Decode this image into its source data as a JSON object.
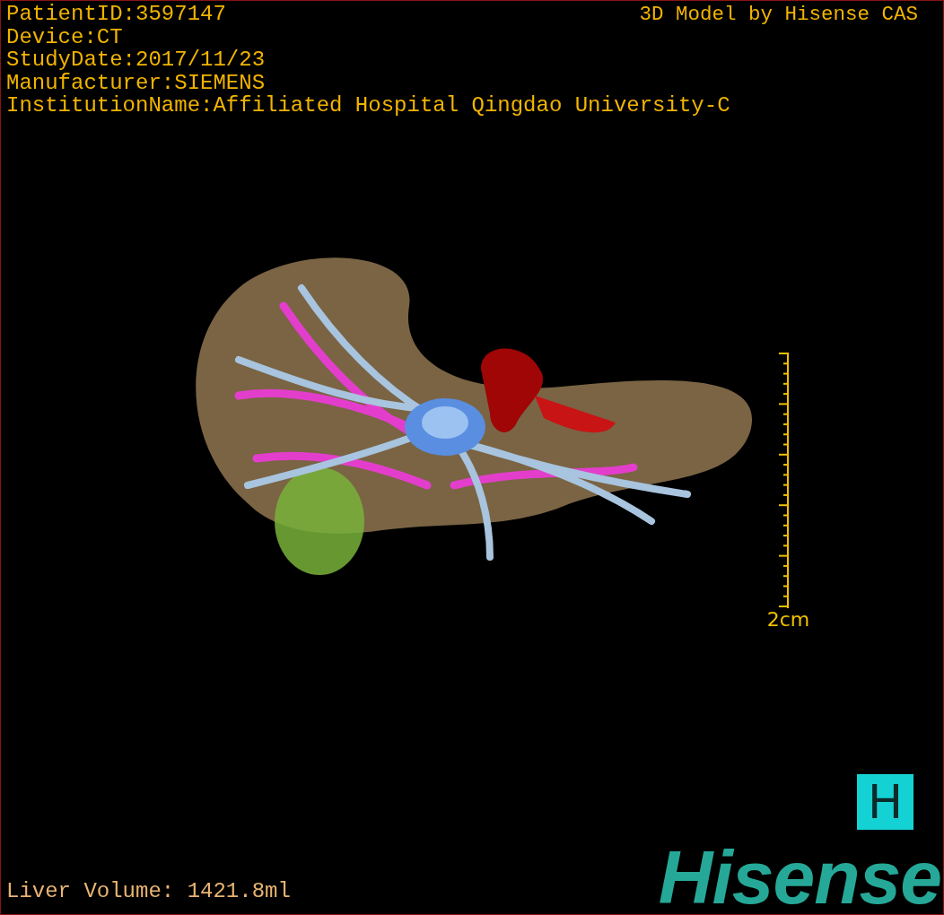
{
  "header": {
    "info_lines": [
      "PatientID:3597147",
      "Device:CT",
      "StudyDate:2017/11/23",
      "Manufacturer:SIEMENS",
      "InstitutionName:Affiliated Hospital Qingdao University-C"
    ],
    "title": "3D Model by Hisense CAS"
  },
  "scale_bar": {
    "label": "2cm"
  },
  "footer": {
    "volume": "Liver Volume: 1421.8ml"
  },
  "logo": {
    "badge": "H",
    "wordmark": "Hisense"
  }
}
